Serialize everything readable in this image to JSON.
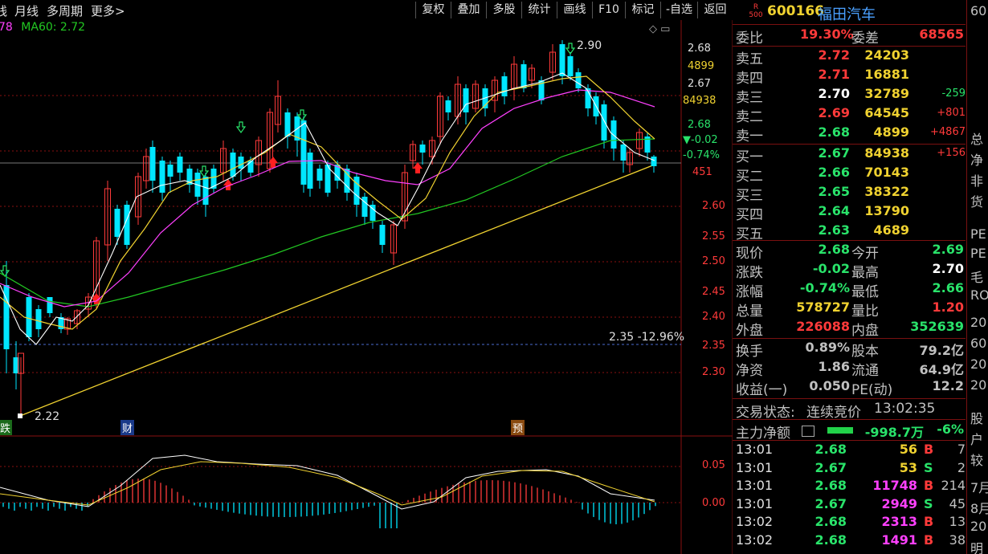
{
  "toolbar": {
    "left_items": [
      "线",
      "月线",
      "多周期",
      "更多>"
    ],
    "buttons": [
      "复权",
      "叠加",
      "多股",
      "统计",
      "画线",
      "F10",
      "标记",
      "-自选",
      "返回"
    ]
  },
  "ma_legend": {
    "partial": "78",
    "ma60": "MA60: 2.72"
  },
  "price_axis": {
    "ticks": [
      "2.60",
      "2.55",
      "2.50",
      "2.45",
      "2.40",
      "2.35",
      "2.30"
    ],
    "top_labels": [
      "2.68",
      "4899",
      "2.67",
      "84938",
      "2.68",
      "▼-0.02",
      "-0.74%",
      "451"
    ]
  },
  "macd_axis": {
    "ticks": [
      "0.05",
      "0.00"
    ]
  },
  "annotations": {
    "high": "2.90",
    "low": "2.22",
    "level": "2.35 -12.96%",
    "markers": [
      "跌",
      "财",
      "预"
    ]
  },
  "stock": {
    "code": "600166",
    "name": "福田汽车",
    "badge_top": "R",
    "badge_bottom": "500"
  },
  "orderbook": {
    "wei_bi_label": "委比",
    "wei_bi": "19.30%",
    "wei_cha_label": "委差",
    "wei_cha": "68565",
    "asks": [
      {
        "label": "卖五",
        "price": "2.72",
        "vol": "24203",
        "chg": ""
      },
      {
        "label": "卖四",
        "price": "2.71",
        "vol": "16881",
        "chg": ""
      },
      {
        "label": "卖三",
        "price": "2.70",
        "vol": "32789",
        "chg": "-259"
      },
      {
        "label": "卖二",
        "price": "2.69",
        "vol": "64545",
        "chg": "+801"
      },
      {
        "label": "卖一",
        "price": "2.68",
        "vol": "4899",
        "chg": "+4867"
      }
    ],
    "bids": [
      {
        "label": "买一",
        "price": "2.67",
        "vol": "84938",
        "chg": "+156"
      },
      {
        "label": "买二",
        "price": "2.66",
        "vol": "70143",
        "chg": ""
      },
      {
        "label": "买三",
        "price": "2.65",
        "vol": "38322",
        "chg": ""
      },
      {
        "label": "买四",
        "price": "2.64",
        "vol": "13790",
        "chg": ""
      },
      {
        "label": "买五",
        "price": "2.63",
        "vol": "4689",
        "chg": ""
      }
    ]
  },
  "quote": [
    {
      "l1": "现价",
      "v1": "2.68",
      "l2": "今开",
      "v2": "2.69"
    },
    {
      "l1": "涨跌",
      "v1": "-0.02",
      "l2": "最高",
      "v2": "2.70"
    },
    {
      "l1": "涨幅",
      "v1": "-0.74%",
      "l2": "最低",
      "v2": "2.66"
    },
    {
      "l1": "总量",
      "v1": "578727",
      "l2": "量比",
      "v2": "1.20"
    },
    {
      "l1": "外盘",
      "v1": "226088",
      "l2": "内盘",
      "v2": "352639"
    }
  ],
  "fund": [
    {
      "l1": "换手",
      "v1": "0.89%",
      "l2": "股本",
      "v2": "79.2亿"
    },
    {
      "l1": "净资",
      "v1": "1.86",
      "l2": "流通",
      "v2": "64.9亿"
    },
    {
      "l1": "收益(一)",
      "v1": "0.050",
      "l2": "PE(动)",
      "v2": "12.2"
    }
  ],
  "trade_status": {
    "label": "交易状态:",
    "value": "连续竞价",
    "time": "13:02:35"
  },
  "net_flow": {
    "label": "主力净额",
    "value": "-998.7万",
    "pct": "-6%"
  },
  "ticks": [
    {
      "time": "13:01",
      "price": "2.68",
      "vol": "56",
      "side": "B",
      "num": "7"
    },
    {
      "time": "13:01",
      "price": "2.67",
      "vol": "53",
      "side": "S",
      "num": "2"
    },
    {
      "time": "13:01",
      "price": "2.68",
      "vol": "11748",
      "side": "B",
      "num": "214"
    },
    {
      "time": "13:01",
      "price": "2.67",
      "vol": "2949",
      "side": "S",
      "num": "45"
    },
    {
      "time": "13:02",
      "price": "2.68",
      "vol": "2313",
      "side": "B",
      "num": "13"
    },
    {
      "time": "13:02",
      "price": "2.68",
      "vol": "1491",
      "side": "B",
      "num": "38"
    }
  ],
  "right_edge": [
    "60",
    "总",
    "净",
    "非",
    "货",
    "PE",
    "PE",
    "毛",
    "RO",
    "20",
    "60",
    "20",
    "20",
    "股",
    "户",
    "较",
    "7月",
    "8月",
    "20",
    "明"
  ],
  "colors": {
    "up": "#ff3a3a",
    "down": "#00e6ff",
    "ma5": "#ffffff",
    "ma10": "#f0d230",
    "ma20": "#ff40ff",
    "ma60": "#22c822",
    "grid": "#8a1010"
  }
}
